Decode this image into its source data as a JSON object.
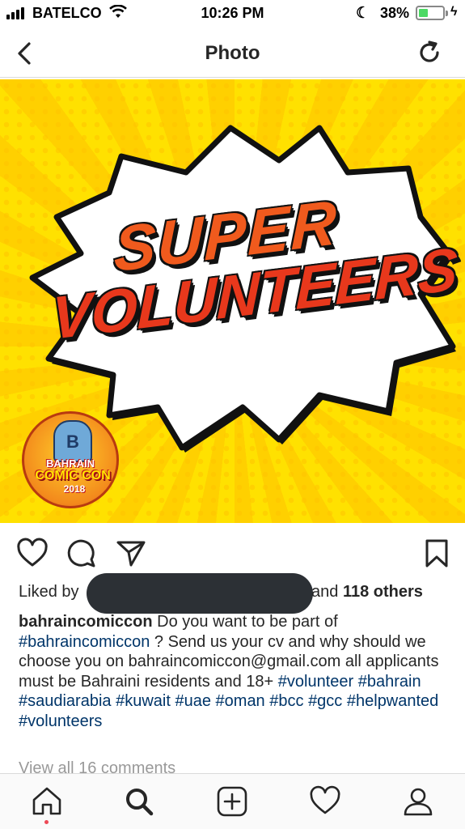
{
  "status_bar": {
    "carrier": "BATELCO",
    "time": "10:26 PM",
    "battery_percent": "38%",
    "battery_level": 0.38
  },
  "nav": {
    "title": "Photo",
    "back_icon": "chevron-left-icon",
    "refresh_icon": "refresh-icon"
  },
  "post": {
    "image_title_line1": "SUPER",
    "image_title_line2": "VOLUNTEERS",
    "logo_line1": "BAHRAIN",
    "logo_line2": "COMIC CON",
    "logo_line3": "2018",
    "logo_letter": "B",
    "likes_prefix": "Liked by",
    "likes_and": "and",
    "likes_count": "118 others",
    "username": "bahraincomiccon",
    "caption_part1": " Do you want to be part of ",
    "tag_bahraincomiccon": "#bahraincomiccon",
    "caption_part2": " ? Send us your cv and why should we choose you on bahraincomiccon@gmail.com all applicants must be Bahraini residents and 18+ ",
    "tag_volunteer": "#volunteer",
    "tag_bahrain": "#bahrain",
    "tag_saudiarabia": "#saudiarabia",
    "tag_kuwait": "#kuwait",
    "tag_uae": "#uae",
    "tag_oman": "#oman",
    "tag_bcc": "#bcc",
    "tag_gcc": "#gcc",
    "tag_helpwanted": "#helpwanted",
    "tag_volunteers": "#volunteers",
    "view_comments": "View all 16 comments"
  },
  "colors": {
    "hashtag": "#003569",
    "notification_dot": "#ed4956",
    "battery_fill": "#4cd964"
  }
}
